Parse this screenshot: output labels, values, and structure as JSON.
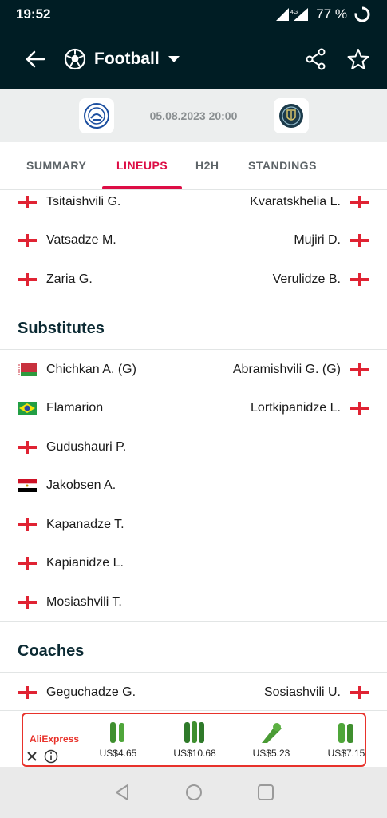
{
  "status": {
    "time": "19:52",
    "battery": "77 %",
    "network": "4G"
  },
  "header": {
    "sport": "Football"
  },
  "match": {
    "datetime": "05.08.2023 20:00"
  },
  "tabs": [
    {
      "label": "SUMMARY",
      "active": false
    },
    {
      "label": "LINEUPS",
      "active": true
    },
    {
      "label": "H2H",
      "active": false
    },
    {
      "label": "STANDINGS",
      "active": false
    }
  ],
  "lineup_tail": [
    {
      "home": "Tsitaishvili G.",
      "home_flag": "georgia",
      "away": "Kvaratskhelia L.",
      "away_flag": "georgia"
    },
    {
      "home": "Vatsadze M.",
      "home_flag": "georgia",
      "away": "Mujiri D.",
      "away_flag": "georgia"
    },
    {
      "home": "Zaria G.",
      "home_flag": "georgia",
      "away": "Verulidze B.",
      "away_flag": "georgia"
    }
  ],
  "substitutes": {
    "title": "Substitutes",
    "rows": [
      {
        "home": "Chichkan A. (G)",
        "home_flag": "belarus",
        "away": "Abramishvili G. (G)",
        "away_flag": "georgia"
      },
      {
        "home": "Flamarion",
        "home_flag": "brazil",
        "away": "Lortkipanidze L.",
        "away_flag": "georgia"
      },
      {
        "home": "Gudushauri P.",
        "home_flag": "georgia",
        "away": "",
        "away_flag": ""
      },
      {
        "home": "Jakobsen A.",
        "home_flag": "egypt",
        "away": "",
        "away_flag": ""
      },
      {
        "home": "Kapanadze T.",
        "home_flag": "georgia",
        "away": "",
        "away_flag": ""
      },
      {
        "home": "Kapianidze L.",
        "home_flag": "georgia",
        "away": "",
        "away_flag": ""
      },
      {
        "home": "Mosiashvili T.",
        "home_flag": "georgia",
        "away": "",
        "away_flag": ""
      }
    ]
  },
  "coaches": {
    "title": "Coaches",
    "rows": [
      {
        "home": "Geguchadze G.",
        "home_flag": "georgia",
        "away": "Sosiashvili U.",
        "away_flag": "georgia"
      }
    ]
  },
  "ad": {
    "brand": "AliExpress",
    "items": [
      {
        "price": "US$4.65"
      },
      {
        "price": "US$10.68"
      },
      {
        "price": "US$5.23"
      },
      {
        "price": "US$7.15"
      }
    ]
  },
  "colors": {
    "header_bg": "#001d24",
    "accent": "#dd0d45",
    "ad_border": "#e8322b"
  },
  "icons": [
    "back-arrow-icon",
    "soccer-ball-icon",
    "dropdown-caret-icon",
    "share-icon",
    "star-icon",
    "signal-icon",
    "battery-icon",
    "nav-back-icon",
    "nav-home-icon",
    "nav-recents-icon",
    "close-icon",
    "info-icon"
  ]
}
